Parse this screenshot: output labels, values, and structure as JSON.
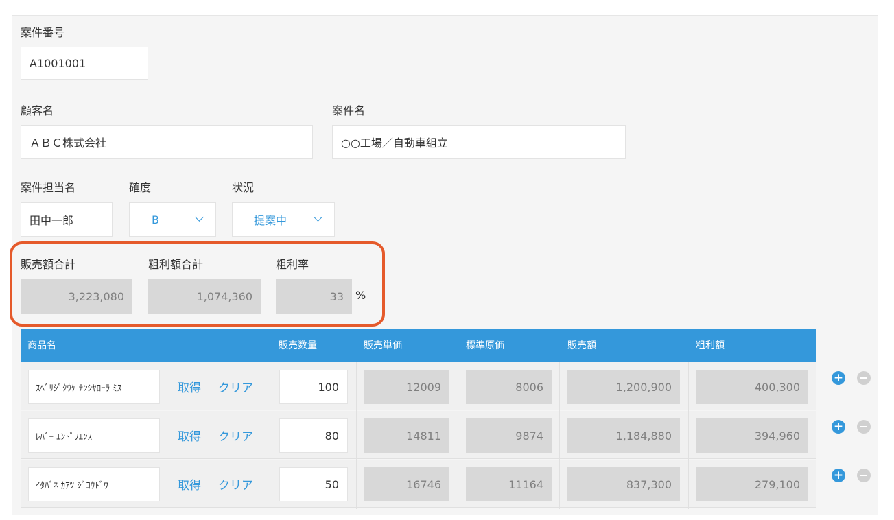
{
  "form": {
    "case_number_label": "案件番号",
    "case_number_value": "A1001001",
    "customer_label": "顧客名",
    "customer_value": "ＡＢＣ株式会社",
    "case_name_label": "案件名",
    "case_name_value": "○○工場／自動車組立",
    "owner_label": "案件担当名",
    "owner_value": "田中一郎",
    "certainty_label": "確度",
    "certainty_value": "B",
    "status_label": "状況",
    "status_value": "提案中"
  },
  "totals": {
    "sales_label": "販売額合計",
    "sales_value": "3,223,080",
    "profit_label": "粗利額合計",
    "profit_value": "1,074,360",
    "rate_label": "粗利率",
    "rate_value": "33",
    "rate_unit": "%"
  },
  "table": {
    "columns": [
      "商品名",
      "販売数量",
      "販売単価",
      "標準原価",
      "販売額",
      "粗利額"
    ],
    "get_label": "取得",
    "clear_label": "クリア",
    "add_symbol": "+",
    "rows": [
      {
        "product": "ｽﾍﾞﾘｼﾞｸｳｹ ﾃﾝｼﾔﾛｰﾗ ﾐｽ",
        "qty": "100",
        "unit_price": "12009",
        "std_cost": "8006",
        "sales": "1,200,900",
        "profit": "400,300"
      },
      {
        "product": "ﾚﾊﾞｰ ｴﾝﾄﾞﾌｴﾝｽ",
        "qty": "80",
        "unit_price": "14811",
        "std_cost": "9874",
        "sales": "1,184,880",
        "profit": "394,960"
      },
      {
        "product": "ｲﾀﾊﾞﾈ ｶｱﾂ ｼﾞｺｳﾄﾞｳ",
        "qty": "50",
        "unit_price": "16746",
        "std_cost": "11164",
        "sales": "837,300",
        "profit": "279,100"
      }
    ]
  },
  "colors": {
    "accent": "#3498db",
    "highlight_border": "#e55a2b",
    "calc_field": "#d8d8d8"
  }
}
